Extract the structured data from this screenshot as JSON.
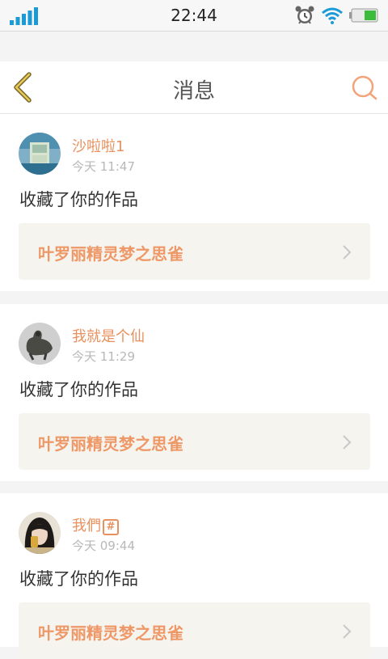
{
  "status_bar": {
    "time": "22:44",
    "icons": [
      "signal-icon",
      "alarm-icon",
      "wifi-icon",
      "battery-icon"
    ],
    "colors": {
      "signal": "#1a9ad6",
      "wifi": "#1a9ad6",
      "battery": "#3dbb3d"
    }
  },
  "header": {
    "title": "消息",
    "back_icon": "chevron-left-icon",
    "search_icon": "search-icon",
    "accent_color": "#e8b84a",
    "search_color": "#f2a37a"
  },
  "messages": [
    {
      "username": "沙啦啦1",
      "badge": "",
      "time": "今天 11:47",
      "action": "收藏了你的作品",
      "work_title": "叶罗丽精灵梦之思雀"
    },
    {
      "username": "我就是个仙",
      "badge": "",
      "time": "今天 11:29",
      "action": "收藏了你的作品",
      "work_title": "叶罗丽精灵梦之思雀"
    },
    {
      "username": "我們",
      "badge": "#",
      "time": "今天 09:44",
      "action": "收藏了你的作品",
      "work_title": "叶罗丽精灵梦之思雀"
    }
  ],
  "colors": {
    "username": "#e8915e",
    "work_title": "#ee9868",
    "work_bg": "#f6f4ef"
  }
}
